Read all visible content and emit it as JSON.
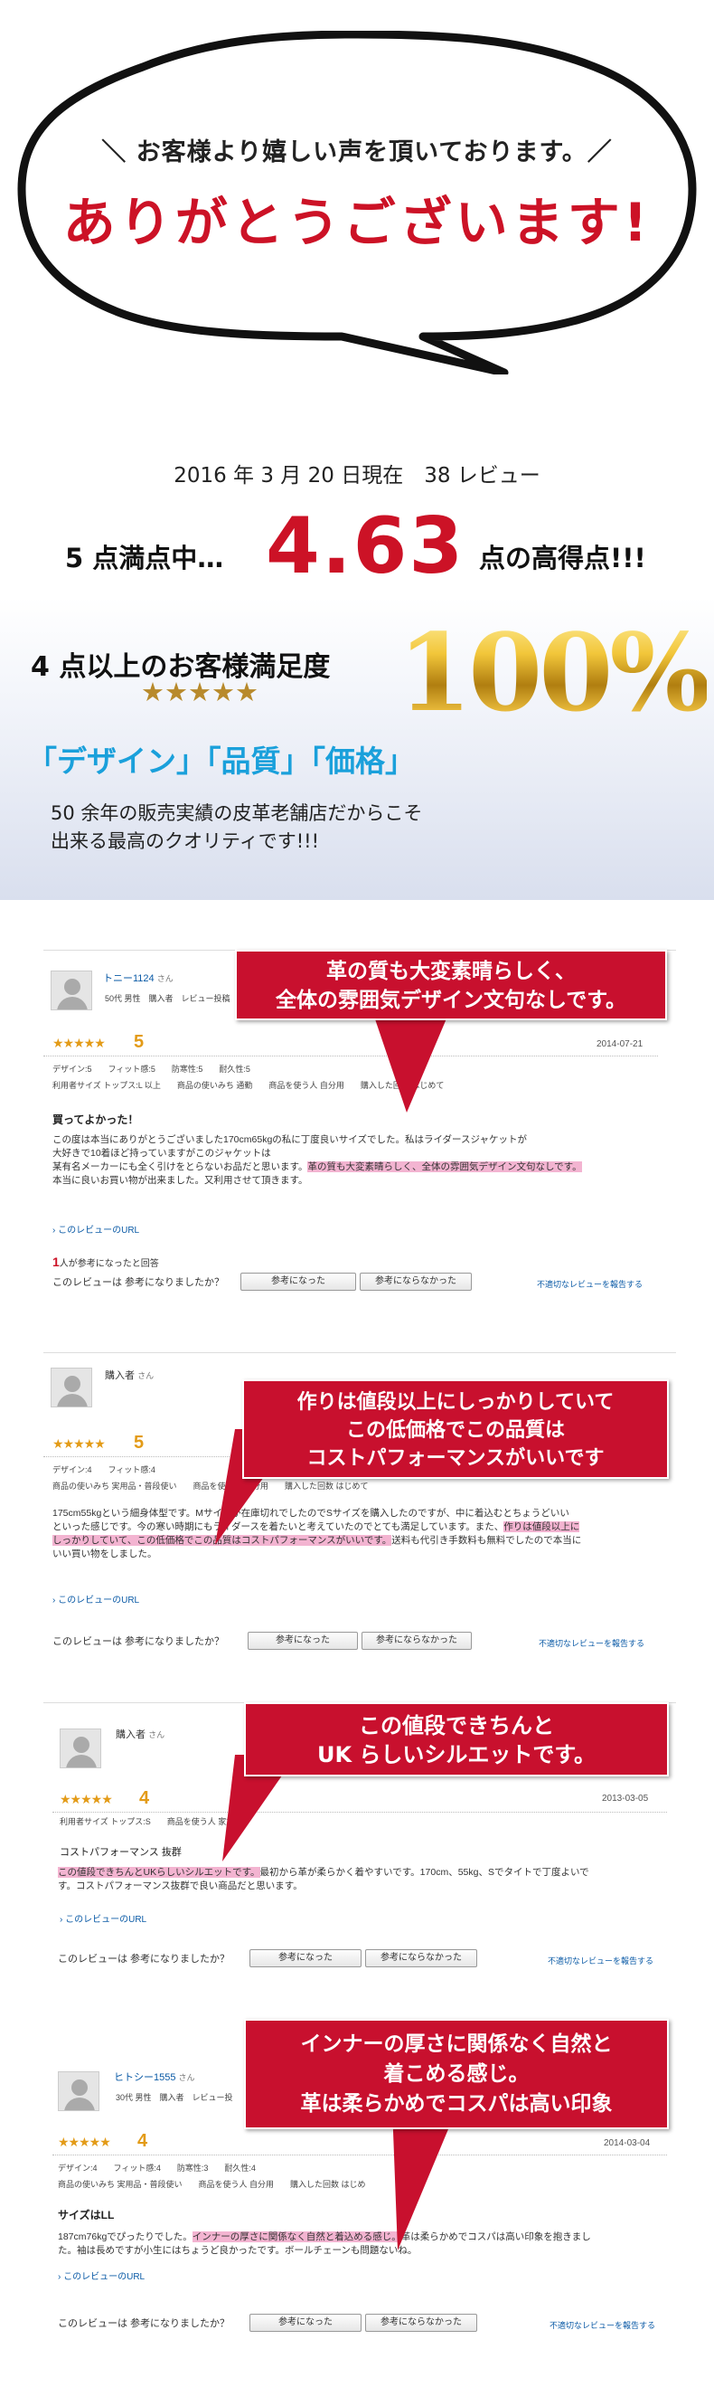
{
  "header": {
    "subtitle": "＼ お客様より嬉しい声を頂いております。／",
    "title": "ありがとうございます!"
  },
  "stats": {
    "date_line": "2016 年 3 月 20 日現在　38 レビュー",
    "score_prefix": "5 点満点中…",
    "score_value": "4.63",
    "score_suffix": "点の高得点!!!",
    "satisfaction_label": "4 点以上のお客様満足度",
    "satisfaction_stars": "★★★★★",
    "satisfaction_value": "100%",
    "tags": "「デザイン」「品質」「価格」",
    "desc_line1": "50 余年の販売実績の皮革老舗店だからこそ",
    "desc_line2": "出来る最高のクオリティです!!!"
  },
  "colors": {
    "accent_red": "#c8102e",
    "link_blue": "#0a5aa6",
    "star_orange": "#e39b17",
    "tag_blue": "#1aa0db",
    "gold": "#d4a419",
    "highlight_pink": "#f3b4d1"
  },
  "reviews": [
    {
      "name": "トニー1124",
      "name_suffix": "さん",
      "meta": "50代 男性　購入者　レビュー投稿",
      "stars": "★★★★★",
      "score": "5",
      "date": "2014-07-21",
      "attrs1": "デザイン:5　　フィット感:5　　防寒性:5　　耐久性:5",
      "attrs2": "利用者サイズ トップス:L 以上　　商品の使いみち 通勤　　商品を使う人 自分用　　購入した回数 はじめて",
      "title": "買ってよかった！",
      "body_a": "この度は本当にありがとうございました170cm65kgの私に丁度良いサイズでした。私はライダースジャケットが",
      "body_b": "大好きで10着ほど持っていますがこのジャケットは",
      "body_c": "某有名メーカーにも全く引けをとらないお品だと思います。",
      "body_hl": "革の質も大変素晴らしく、全体の雰囲気デザイン文句なしです。",
      "body_d": "本当に良いお買い物が出来ました。又利用させて頂きます。",
      "link": "› このレビューのURL",
      "helpful_count": "1",
      "helpful_text": "人が参考になったと回答",
      "question": "このレビューは 参考になりましたか？",
      "btn_yes": "参考になった",
      "btn_no": "参考にならなかった",
      "report": "不適切なレビューを報告する",
      "callout1": "革の質も大変素晴らしく、",
      "callout2": "全体の雰囲気デザイン文句なしです。"
    },
    {
      "name": "購入者",
      "name_suffix": "さん",
      "stars": "★★★★★",
      "score": "5",
      "attrs1": "デザイン:4　　フィット感:4",
      "attrs2": "商品の使いみち 実用品・普段使い　　商品を使う人 自分用　　購入した回数 はじめて",
      "body_a": "175cm55kgという細身体型です。Mサイズが在庫切れでしたのでSサイズを購入したのですが、中に着込むとちょうどいい",
      "body_b": "といった感じです。今の寒い時期にもライダースを着たいと考えていたのでとても満足しています。また、",
      "body_hl1": "作りは値段以上に",
      "body_hl2": "しっかりしていて、この低価格でこの品質はコストパフォーマンスがいいです。",
      "body_c": "送料も代引き手数料も無料でしたので本当に",
      "body_d": "いい買い物をしました。",
      "link": "› このレビューのURL",
      "question": "このレビューは 参考になりましたか？",
      "btn_yes": "参考になった",
      "btn_no": "参考にならなかった",
      "report": "不適切なレビューを報告する",
      "callout1": "作りは値段以上にしっかりしていて",
      "callout2": "この低価格でこの品質は",
      "callout3": "コストパフォーマンスがいいです"
    },
    {
      "name": "購入者",
      "name_suffix": "さん",
      "stars": "★★★★★",
      "score": "4",
      "date": "2013-03-05",
      "attrs1": "利用者サイズ トップス:S　　商品を使う人 家族へ",
      "title": "コストパフォーマンス 抜群",
      "body_hl": "この値段できちんとUKらしいシルエットです。",
      "body_a": "最初から革が柔らかく着やすいです。170cm、55kg、Sでタイトで丁度よいで",
      "body_b": "す。コストパフォーマンス抜群で良い商品だと思います。",
      "link": "› このレビューのURL",
      "question": "このレビューは 参考になりましたか？",
      "btn_yes": "参考になった",
      "btn_no": "参考にならなかった",
      "report": "不適切なレビューを報告する",
      "callout1": "この値段できちんと",
      "callout2": "UK らしいシルエットです。"
    },
    {
      "name": "ヒトシー1555",
      "name_suffix": "さん",
      "meta": "30代 男性　購入者　レビュー投",
      "stars": "★★★★★",
      "score": "4",
      "date": "2014-03-04",
      "attrs1": "デザイン:4　　フィット感:4　　防寒性:3　　耐久性:4",
      "attrs2": "商品の使いみち 実用品・普段使い　　商品を使う人 自分用　　購入した回数 はじめ",
      "title": "サイズはLL",
      "body_a": "187cm76kgでぴったりでした。",
      "body_hl1": "インナーの厚さに関係なく自然と着込める感じ。",
      "body_b": "革は柔らかめでコスパは高い印象",
      "body_c": "を抱きまし",
      "body_d": "た。袖は長めですが小生にはちょうど良かったです。ボールチェーンも問題ないね。",
      "link": "› このレビューのURL",
      "question": "このレビューは 参考になりましたか？",
      "btn_yes": "参考になった",
      "btn_no": "参考にならなかった",
      "report": "不適切なレビューを報告する",
      "callout1": "インナーの厚さに関係なく自然と",
      "callout2": "着こめる感じ。",
      "callout3": "革は柔らかめでコスパは高い印象"
    }
  ]
}
